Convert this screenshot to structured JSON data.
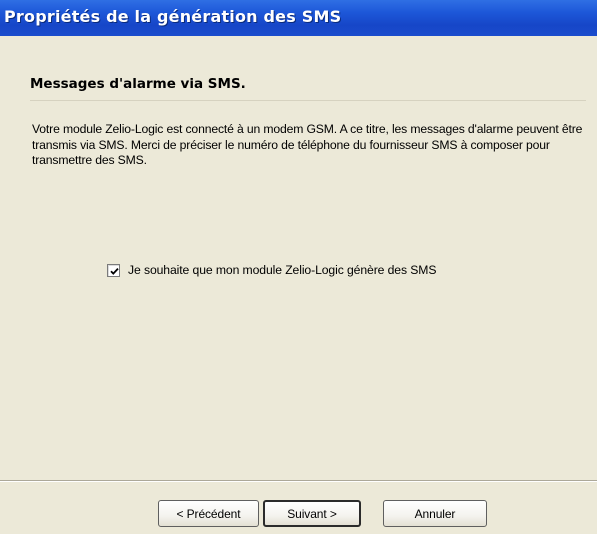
{
  "window": {
    "title": "Propriétés de la génération des SMS"
  },
  "header": {
    "title": "Messages d'alarme via SMS."
  },
  "body": {
    "description": "Votre module Zelio-Logic est connecté à un modem GSM. A ce titre, les messages d'alarme peuvent être transmis via SMS. Merci de préciser le numéro de téléphone du fournisseur SMS à composer pour transmettre des SMS."
  },
  "option": {
    "checked": true,
    "label": "Je souhaite que mon module Zelio-Logic génère des SMS"
  },
  "buttons": {
    "previous": "< Précédent",
    "next": "Suivant >",
    "cancel": "Annuler"
  }
}
